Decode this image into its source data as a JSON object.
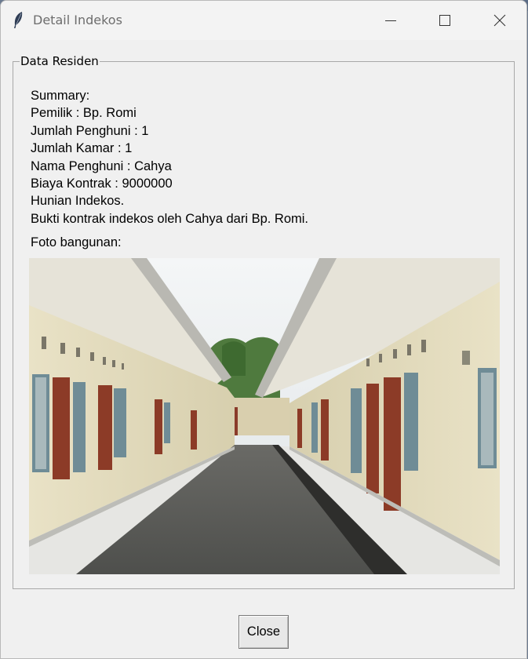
{
  "window": {
    "title": "Detail Indekos",
    "app_icon": "feather-icon"
  },
  "frame": {
    "legend": "Data Residen"
  },
  "summary": {
    "lines": [
      "Summary:",
      "Pemilik : Bp. Romi",
      "Jumlah Penghuni : 1",
      "Jumlah Kamar : 1",
      "Nama Penghuni : Cahya",
      "Biaya Kontrak : 9000000",
      "Hunian Indekos.",
      "Bukti kontrak indekos oleh Cahya dari Bp. Romi."
    ]
  },
  "photo": {
    "label": "Foto bangunan:"
  },
  "buttons": {
    "close_label": "Close"
  }
}
